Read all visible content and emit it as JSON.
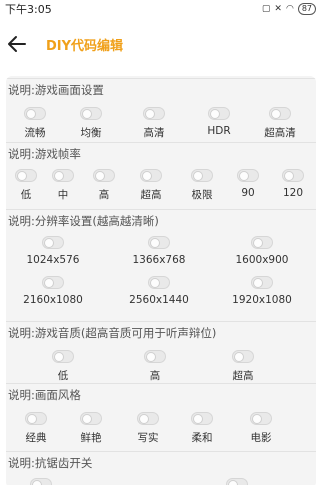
{
  "status": {
    "time": "下午3:05",
    "battery": "87"
  },
  "header": {
    "title": "DIY代码编辑"
  },
  "sections": [
    {
      "label": "说明:游戏画面设置",
      "options": [
        "流畅",
        "均衡",
        "高清",
        "HDR",
        "超高清"
      ]
    },
    {
      "label": "说明:游戏帧率",
      "options": [
        "低",
        "中",
        "高",
        "超高",
        "极限",
        "90",
        "120"
      ]
    },
    {
      "label": "说明:分辨率设置(越高越清晰)",
      "options": [
        "1024x576",
        "1366x768",
        "1600x900",
        "2160x1080",
        "2560x1440",
        "1920x1080"
      ]
    },
    {
      "label": "说明:游戏音质(超高音质可用于听声辩位)",
      "options": [
        "低",
        "高",
        "超高"
      ]
    },
    {
      "label": "说明:画面风格",
      "options": [
        "经典",
        "鲜艳",
        "写实",
        "柔和",
        "电影"
      ]
    },
    {
      "label": "说明:抗锯齿开关",
      "options": []
    }
  ]
}
